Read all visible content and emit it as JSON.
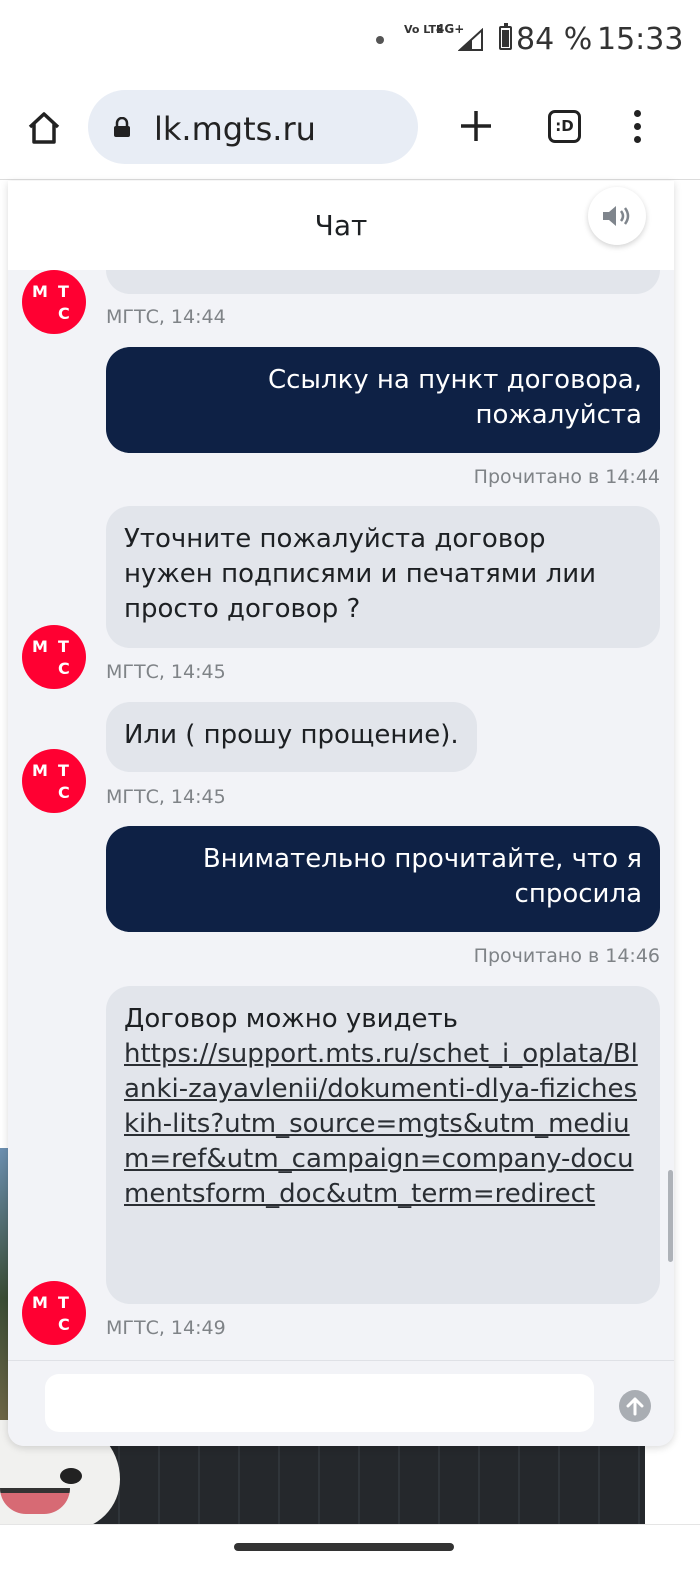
{
  "status_bar": {
    "volte": "Vo LTE",
    "network": "4G+",
    "battery": "84 %",
    "battery_level": 0.84,
    "time": "15:33"
  },
  "browser": {
    "url": "lk.mgts.ru",
    "tabs_label": ":D",
    "icons": [
      "home-icon",
      "lock-icon",
      "plus-icon",
      "tabs-icon",
      "more-vert-icon"
    ]
  },
  "chat": {
    "title": "Чат",
    "sound_icon": "speaker-icon",
    "avatar_letters": [
      "М",
      "Т",
      "С"
    ],
    "messages": [
      {
        "from": "bot",
        "text": "",
        "meta": "МГТС, 14:44"
      },
      {
        "from": "user",
        "text": "Ссылку на пункт договора, пожалуйста",
        "meta": "Прочитано в 14:44"
      },
      {
        "from": "bot",
        "text": "Уточните пожалуйста договор нужен подписями и печатями лии просто договор ?",
        "meta": "МГТС, 14:45"
      },
      {
        "from": "bot",
        "text": "Или ( прошу прощение).",
        "meta": "МГТС, 14:45"
      },
      {
        "from": "user",
        "text": "Внимательно прочитайте, что я спросила",
        "meta": "Прочитано в 14:46"
      },
      {
        "from": "bot",
        "text": "Договор можно увидеть",
        "link": "https://support.mts.ru/schet_i_oplata/Blanki-zayavlenii/dokumenti-dlya-fizicheskih-lits?utm_source=mgts&utm_medium=ref&utm_campaign=company-documentsform_doc&utm_term=redirect",
        "meta": "МГТС, 14:49"
      }
    ],
    "composer_placeholder": "",
    "send_icon": "arrow-up-icon"
  }
}
